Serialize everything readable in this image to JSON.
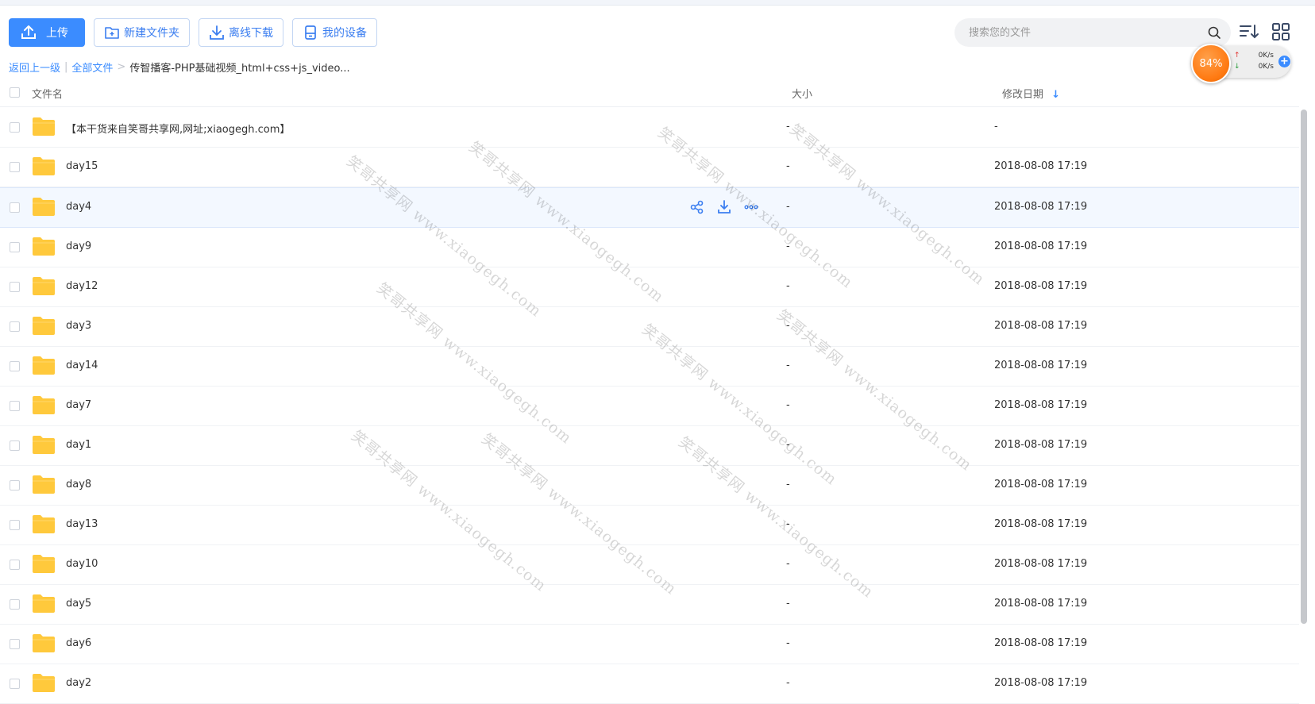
{
  "toolbar": {
    "upload_label": "上传",
    "new_folder_label": "新建文件夹",
    "offline_download_label": "离线下载",
    "my_devices_label": "我的设备"
  },
  "search": {
    "placeholder": "搜索您的文件"
  },
  "breadcrumb": {
    "back": "返回上一级",
    "divider": "|",
    "all_files": "全部文件",
    "separator": ">",
    "current": "传智播客-PHP基础视频_html+css+js_video..."
  },
  "speed_widget": {
    "percent": "84%",
    "up_arrow": "↑",
    "down_arrow": "↓",
    "upload_speed": "0K/s",
    "download_speed": "0K/s",
    "plus": "+"
  },
  "table": {
    "col_name": "文件名",
    "col_size": "大小",
    "col_date": "修改日期",
    "sort_arrow": "↓",
    "rows": [
      {
        "name": "【本干货来自笑哥共享网,网址;xiaogegh.com】",
        "size": "-",
        "date": "-"
      },
      {
        "name": "day15",
        "size": "-",
        "date": "2018-08-08 17:19"
      },
      {
        "name": "day4",
        "size": "-",
        "date": "2018-08-08 17:19"
      },
      {
        "name": "day9",
        "size": "-",
        "date": "2018-08-08 17:19"
      },
      {
        "name": "day12",
        "size": "-",
        "date": "2018-08-08 17:19"
      },
      {
        "name": "day3",
        "size": "-",
        "date": "2018-08-08 17:19"
      },
      {
        "name": "day14",
        "size": "-",
        "date": "2018-08-08 17:19"
      },
      {
        "name": "day7",
        "size": "-",
        "date": "2018-08-08 17:19"
      },
      {
        "name": "day1",
        "size": "-",
        "date": "2018-08-08 17:19"
      },
      {
        "name": "day8",
        "size": "-",
        "date": "2018-08-08 17:19"
      },
      {
        "name": "day13",
        "size": "-",
        "date": "2018-08-08 17:19"
      },
      {
        "name": "day10",
        "size": "-",
        "date": "2018-08-08 17:19"
      },
      {
        "name": "day5",
        "size": "-",
        "date": "2018-08-08 17:19"
      },
      {
        "name": "day6",
        "size": "-",
        "date": "2018-08-08 17:19"
      },
      {
        "name": "day2",
        "size": "-",
        "date": "2018-08-08 17:19"
      }
    ]
  },
  "watermark": "笑哥共享网 www.xiaogegh.com",
  "colors": {
    "accent": "#3b8cff",
    "folder": "#ffc93c",
    "speed_badge": "#ff7a12"
  }
}
